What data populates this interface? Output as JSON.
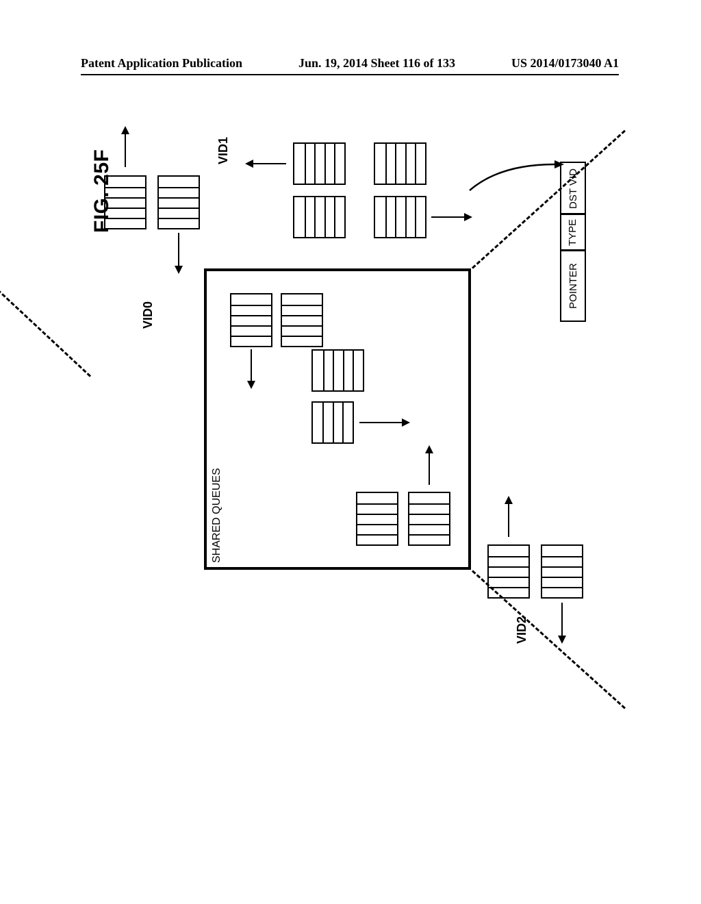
{
  "header": {
    "left": "Patent Application Publication",
    "center": "Jun. 19, 2014  Sheet 116 of 133",
    "right": "US 2014/0173040 A1"
  },
  "figure": {
    "title": "FIG. 25F",
    "shared_queues_label": "SHARED QUEUES",
    "labels": {
      "vid0": "VID0",
      "vid1": "VID1",
      "vid2": "VID2"
    },
    "message_fields": {
      "pointer": "POINTER",
      "type": "TYPE",
      "dst_vid": "DST VID"
    }
  }
}
